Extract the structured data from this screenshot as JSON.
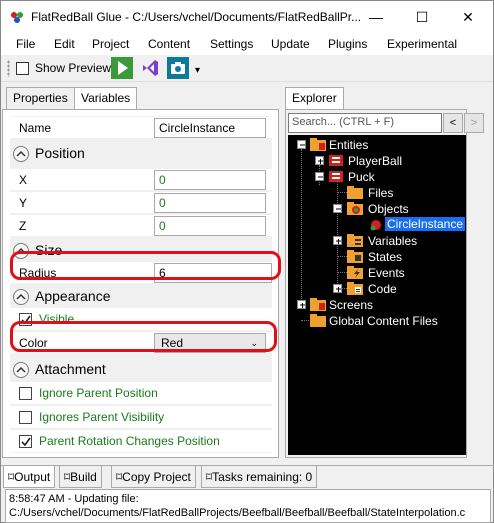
{
  "window": {
    "title": "FlatRedBall Glue - C:/Users/vchel/Documents/FlatRedBallPr...",
    "minimize": "—",
    "maximize": "☐",
    "close": "✕"
  },
  "menu": [
    "File",
    "Edit",
    "Project",
    "Content",
    "Settings",
    "Update",
    "Plugins",
    "Experimental"
  ],
  "toolbar": {
    "show_preview_label": "Show Preview",
    "show_preview_checked": false,
    "buttons": [
      "play-icon",
      "visual-studio-icon",
      "camera-icon"
    ],
    "overflow": "▾"
  },
  "left_tabs": [
    "Properties",
    "Variables"
  ],
  "left_active_tab": "Variables",
  "props": {
    "name_label": "Name",
    "name_value": "CircleInstance",
    "position": {
      "title": "Position",
      "x_label": "X",
      "x_value": "0",
      "y_label": "Y",
      "y_value": "0",
      "z_label": "Z",
      "z_value": "0"
    },
    "size": {
      "title": "Size",
      "radius_label": "Radius",
      "radius_value": "6"
    },
    "appearance": {
      "title": "Appearance",
      "visible_label": "Visible",
      "visible_checked": true,
      "color_label": "Color",
      "color_value": "Red"
    },
    "attachment": {
      "title": "Attachment",
      "ignore_parent_position": "Ignore Parent Position",
      "ignore_parent_position_checked": false,
      "ignores_parent_visibility": "Ignores Parent Visibility",
      "ignores_parent_visibility_checked": false,
      "parent_rotation": "Parent Rotation Changes Position",
      "parent_rotation_checked": true
    }
  },
  "explorer": {
    "tab": "Explorer",
    "search_placeholder": "Search... (CTRL + F)",
    "back": "<",
    "forward": ">",
    "tree": {
      "entities": "Entities",
      "playerball": "PlayerBall",
      "puck": "Puck",
      "files": "Files",
      "objects": "Objects",
      "circle_instance": "CircleInstance",
      "variables": "Variables",
      "states": "States",
      "events": "Events",
      "code": "Code",
      "screens": "Screens",
      "global_content": "Global Content Files"
    }
  },
  "bottom_tabs": [
    "Output",
    "Build",
    "Copy Project",
    "Tasks remaining: 0"
  ],
  "output_lines": [
    "8:58:47 AM - Updating file:",
    "C:/Users/vchel/Documents/FlatRedBallProjects/Beefball/Beefball/Beefball/StateInterpolation.c"
  ],
  "colors": {
    "accent_red": "#e0101a",
    "selection": "#1a6ff0",
    "green_text": "#1a7a1a",
    "folder": "#f0a030"
  }
}
